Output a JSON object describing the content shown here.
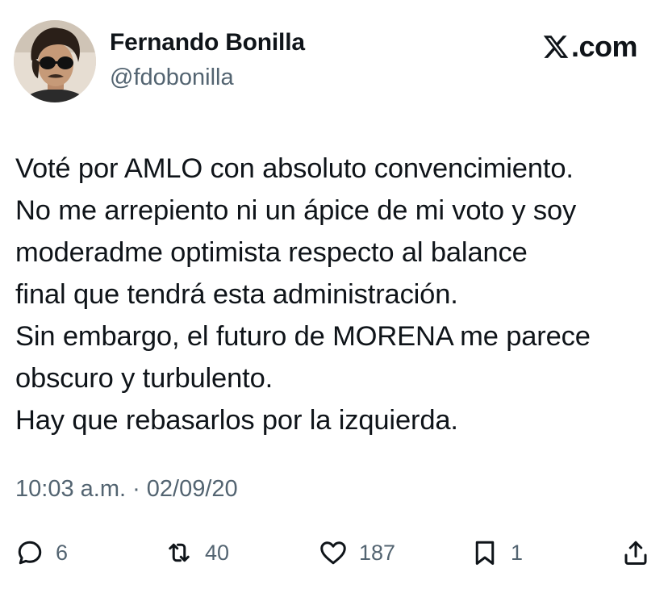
{
  "author": {
    "name": "Fernando Bonilla",
    "handle": "@fdobonilla"
  },
  "brand": {
    "suffix": ".com",
    "logo_icon": "x-logo-icon"
  },
  "tweet": {
    "lines": [
      "Voté por AMLO con absoluto convencimiento.",
      "No me arrepiento ni un ápice de mi voto y soy",
      "moderadme optimista respecto al balance",
      "final que tendrá esta administración.",
      "Sin embargo, el futuro de MORENA me parece",
      "obscuro y turbulento.",
      "Hay que rebasarlos por la izquierda."
    ],
    "timestamp": "10:03 a.m. · 02/09/20"
  },
  "actions": {
    "replies": "6",
    "retweets": "40",
    "likes": "187",
    "bookmarks": "1"
  },
  "colors": {
    "text": "#0f1419",
    "secondary": "#536471",
    "background": "#ffffff"
  }
}
